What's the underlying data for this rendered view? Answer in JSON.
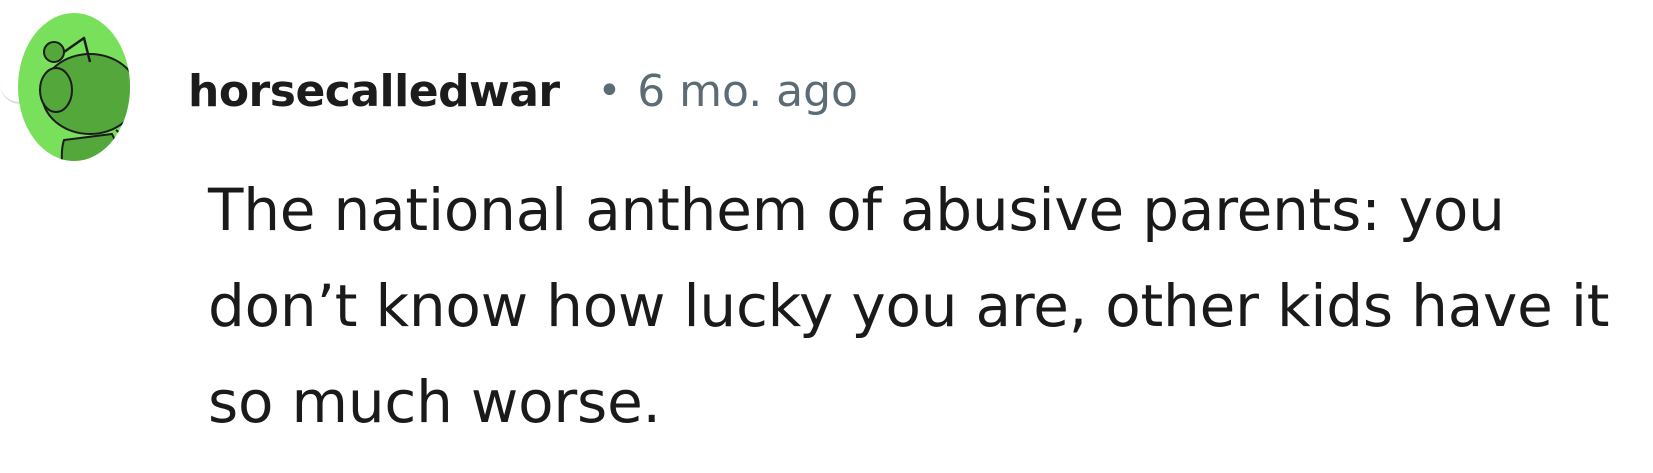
{
  "comment": {
    "username": "horsecalledwar",
    "separator": "•",
    "timestamp": "6 mo. ago",
    "body": "The national anthem of abusive parents: you don’t know how lucky you are, other kids have it so much worse."
  },
  "avatar": {
    "icon": "snoo-avatar-icon",
    "background_color": "#79e05b",
    "body_color": "#54a73a",
    "outline_color": "#1c1c1c"
  },
  "colors": {
    "username": "#1c1c1c",
    "meta": "#5c6c74",
    "body": "#1a1a1b"
  }
}
